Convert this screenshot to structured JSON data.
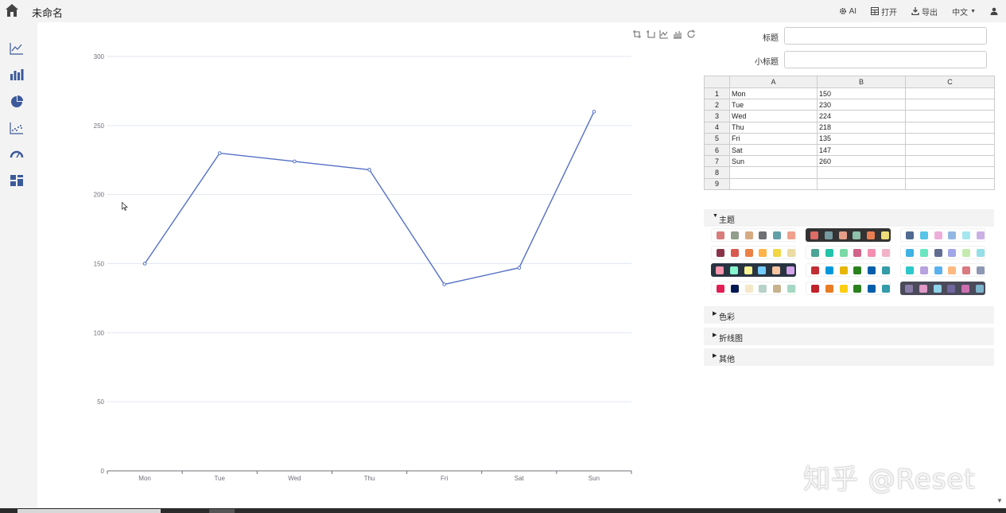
{
  "app": {
    "doc_title": "未命名"
  },
  "toolbar": {
    "ai": "AI",
    "open": "打开",
    "export": "导出",
    "lang": "中文"
  },
  "sidebar": {
    "items": [
      "line-chart-icon",
      "bar-chart-icon",
      "pie-chart-icon",
      "scatter-chart-icon",
      "gauge-icon",
      "dashboard-icon"
    ]
  },
  "form": {
    "title_label": "标题",
    "title_value": "",
    "subtitle_label": "小标题",
    "subtitle_value": ""
  },
  "sheet": {
    "columns": [
      "A",
      "B",
      "C"
    ],
    "rows": [
      [
        "1",
        "Mon",
        "150",
        ""
      ],
      [
        "2",
        "Tue",
        "230",
        ""
      ],
      [
        "3",
        "Wed",
        "224",
        ""
      ],
      [
        "4",
        "Thu",
        "218",
        ""
      ],
      [
        "5",
        "Fri",
        "135",
        ""
      ],
      [
        "6",
        "Sat",
        "147",
        ""
      ],
      [
        "7",
        "Sun",
        "260",
        ""
      ],
      [
        "8",
        "",
        "",
        ""
      ],
      [
        "9",
        "",
        "",
        ""
      ]
    ]
  },
  "sections": {
    "theme": "主题",
    "color": "色彩",
    "line": "折线图",
    "other": "其他"
  },
  "themes": [
    {
      "bg": "#ffffff",
      "selected": false,
      "colors": [
        "#d87c7c",
        "#919e8b",
        "#d7ab82",
        "#6e7074",
        "#61a0a8",
        "#efa18d"
      ]
    },
    {
      "bg": "#333333",
      "selected": true,
      "colors": [
        "#dd6b66",
        "#759aa0",
        "#e69d87",
        "#8dc1a9",
        "#ea7e53",
        "#eedd78"
      ]
    },
    {
      "bg": "#ffffff",
      "selected": false,
      "colors": [
        "#516b91",
        "#59c4e6",
        "#edafda",
        "#93b7e3",
        "#a5e7f0",
        "#cbb0e3"
      ]
    },
    {
      "bg": "#ffffff",
      "selected": false,
      "colors": [
        "#893448",
        "#d95850",
        "#eb8146",
        "#ffb248",
        "#f2d643",
        "#ebdba4"
      ]
    },
    {
      "bg": "#ffffff",
      "selected": false,
      "colors": [
        "#4ea397",
        "#22c3aa",
        "#7bd9a5",
        "#d0648a",
        "#f58db2",
        "#f2b3c9"
      ]
    },
    {
      "bg": "#ffffff",
      "selected": false,
      "colors": [
        "#3fb1e3",
        "#6be6c1",
        "#626c91",
        "#a0a7e6",
        "#c4ebad",
        "#96dee8"
      ]
    },
    {
      "bg": "#293441",
      "selected": true,
      "colors": [
        "#fc97af",
        "#87f7cf",
        "#f7f494",
        "#72ccff",
        "#f7c5a0",
        "#d4a4eb"
      ]
    },
    {
      "bg": "#ffffff",
      "selected": false,
      "colors": [
        "#c12e34",
        "#0098d9",
        "#e6b600",
        "#2b821d",
        "#005eaa",
        "#339ca8"
      ]
    },
    {
      "bg": "#ffffff",
      "selected": false,
      "colors": [
        "#2ec7c9",
        "#b6a2de",
        "#5ab1ef",
        "#ffb980",
        "#d87a80",
        "#8d98b3"
      ]
    },
    {
      "bg": "#ffffff",
      "selected": false,
      "colors": [
        "#e01f54",
        "#001852",
        "#f5e8c8",
        "#b8d2c7",
        "#c6b38e",
        "#a4d8c2"
      ]
    },
    {
      "bg": "#ffffff",
      "selected": false,
      "colors": [
        "#c1232b",
        "#e87c25",
        "#fcce10",
        "#2b821d",
        "#005eaa",
        "#339ca8"
      ]
    },
    {
      "bg": "#4a4a5a",
      "selected": true,
      "colors": [
        "#8a7ca8",
        "#e098c7",
        "#8fd3e8",
        "#71669e",
        "#cc70af",
        "#7cb4cc"
      ]
    }
  ],
  "colors": {
    "line": "#5470c6",
    "accent": "#3c4e7a",
    "grid": "#e0e6f1",
    "axis": "#6e7079"
  },
  "chart_data": {
    "type": "line",
    "categories": [
      "Mon",
      "Tue",
      "Wed",
      "Thu",
      "Fri",
      "Sat",
      "Sun"
    ],
    "values": [
      150,
      230,
      224,
      218,
      135,
      147,
      260
    ],
    "ylim": [
      0,
      300
    ],
    "yticks": [
      0,
      50,
      100,
      150,
      200,
      250,
      300
    ],
    "grid": true
  },
  "watermark": "知乎 @Reset"
}
